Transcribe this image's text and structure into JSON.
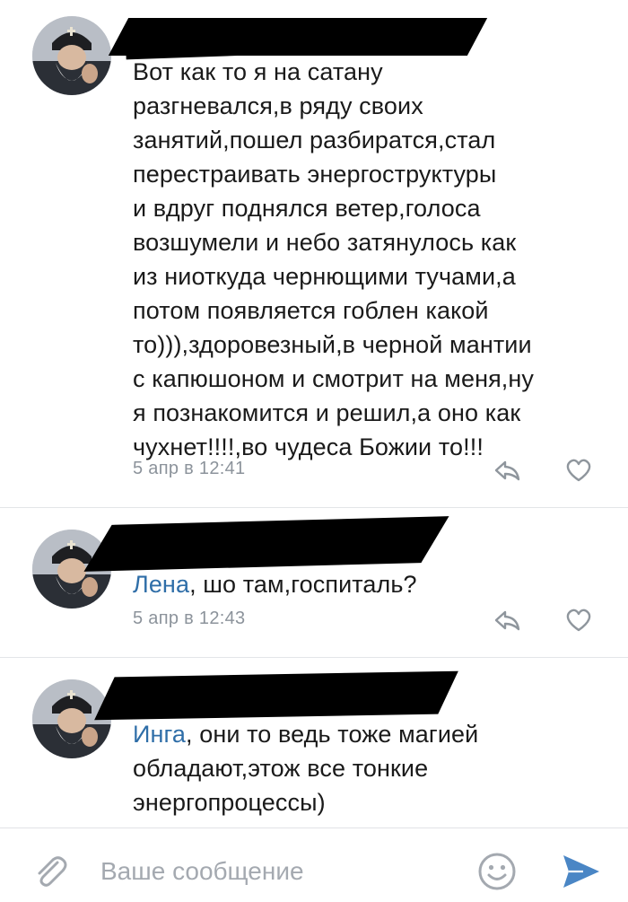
{
  "comments": [
    {
      "lines": [
        "Вот как то я на сатану",
        "разгневался,в ряду своих",
        "занятий,пошел разбиратся,стал",
        "перестраивать энергоструктуры",
        "и вдруг поднялся ветер,голоса",
        "возшумели и небо затянулось как",
        "из ниоткуда чернющими тучами,а",
        "потом появляется гоблен какой",
        "то))),здоровезный,в черной мантии",
        "с капюшоном и смотрит на меня,ну",
        "я познакомится и решил,а оно как",
        "чухнет!!!!,во чудеса Божии то!!!"
      ],
      "time": "5 апр в 12:41"
    },
    {
      "mention": "Лена",
      "text": ", шо там,госпиталь?",
      "time": "5 апр в 12:43"
    },
    {
      "mention": "Инга",
      "lines": [
        ", они то ведь тоже магией",
        "обладают,этож все тонкие",
        "энергопроцессы)"
      ]
    }
  ],
  "composer": {
    "placeholder": "Ваше сообщение"
  },
  "icons": {
    "reply": "reply-arrow-icon",
    "like": "heart-icon",
    "attach": "paperclip-icon",
    "emoji": "smile-icon",
    "send": "send-icon"
  },
  "colors": {
    "mention": "#2f6ea8",
    "timestamp": "#8c939b",
    "accent": "#4a86c5"
  }
}
